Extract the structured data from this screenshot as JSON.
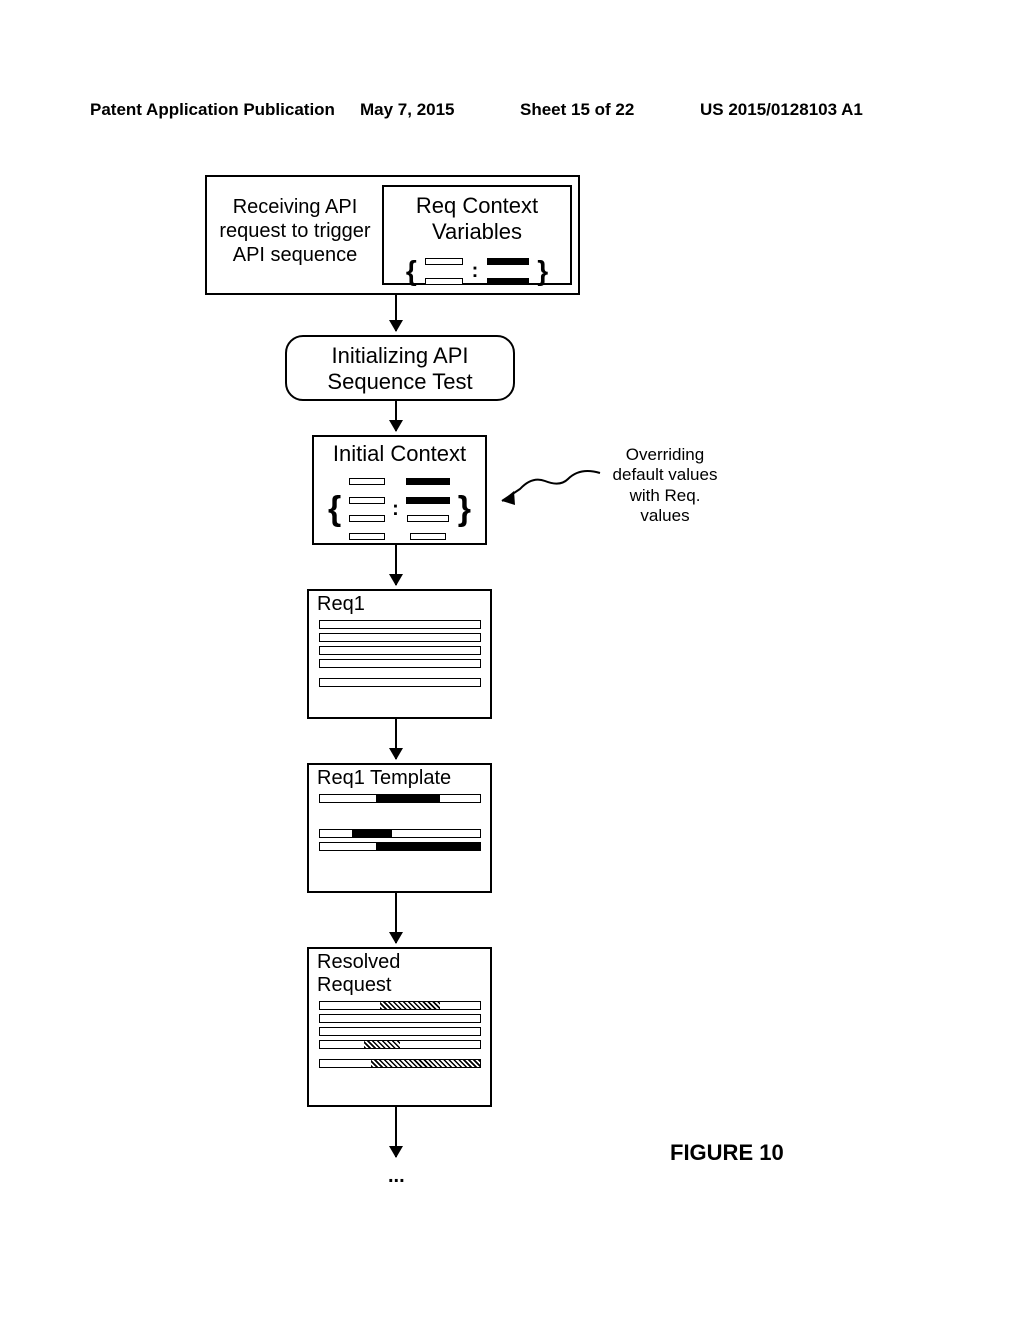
{
  "header": {
    "left": "Patent Application Publication",
    "date": "May 7, 2015",
    "sheet": "Sheet 15 of 22",
    "docnum": "US 2015/0128103 A1"
  },
  "boxes": {
    "receiving": "Receiving API request to trigger API sequence",
    "reqcontext": "Req Context Variables",
    "init": "Initializing API Sequence Test",
    "initialcontext": "Initial Context",
    "req1": "Req1",
    "req1template": "Req1 Template",
    "resolved_line1": "Resolved",
    "resolved_line2": "Request"
  },
  "annotation": "Overriding default values with Req. values",
  "figure": "FIGURE 10",
  "ellipsis": "..."
}
